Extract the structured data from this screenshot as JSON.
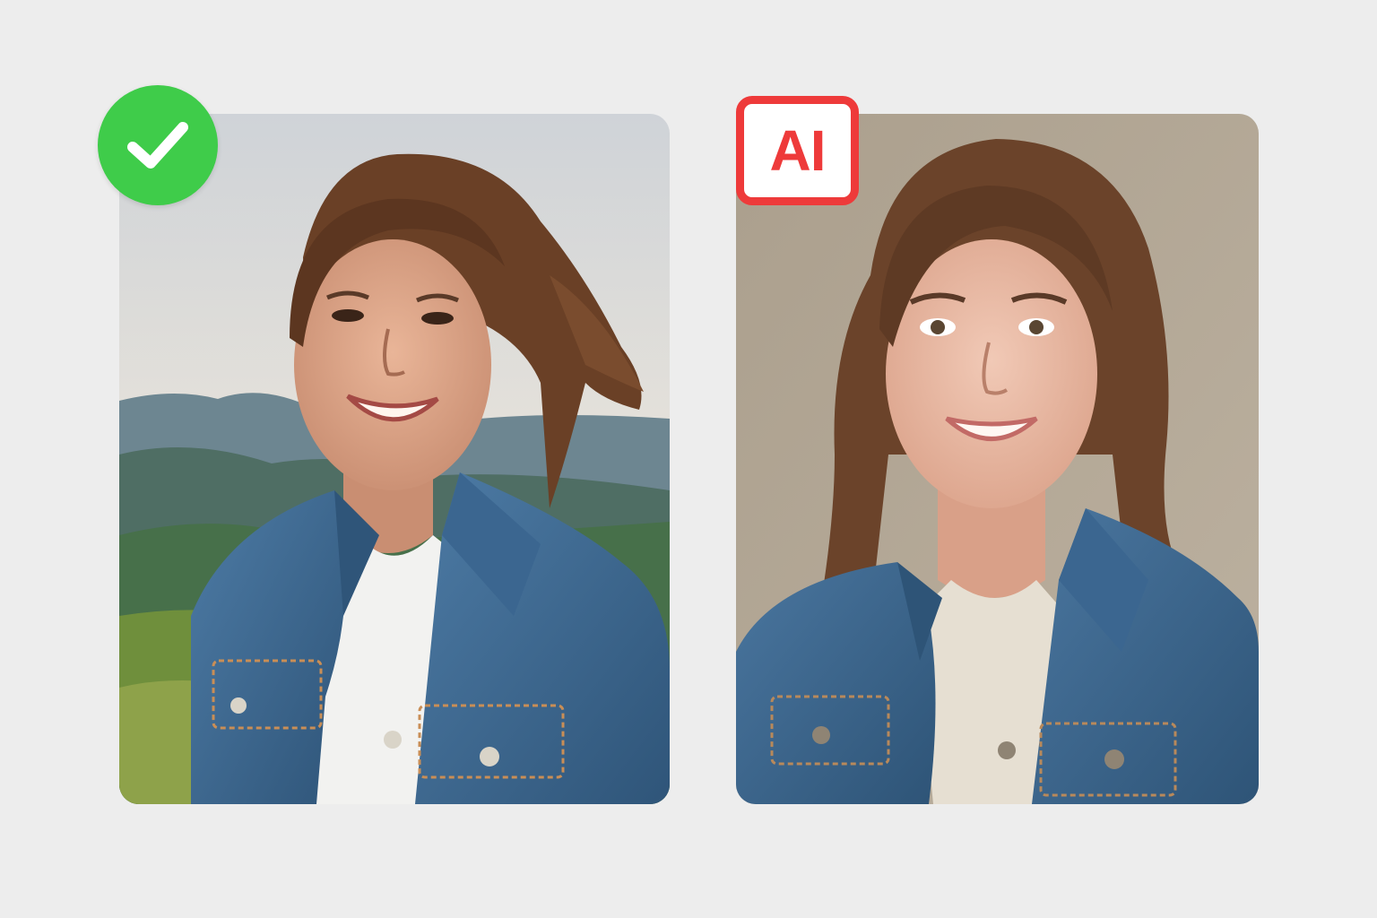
{
  "badges": {
    "real": {
      "icon": "check-icon",
      "color": "#3fcc4a"
    },
    "ai": {
      "label": "AI",
      "color": "#ee3a3a"
    }
  },
  "photos": {
    "real": {
      "subject": "photo-real-portrait"
    },
    "ai": {
      "subject": "photo-ai-portrait"
    }
  },
  "colors": {
    "background": "#ededed",
    "denim": "#3e6a95",
    "hair": "#6a4026"
  }
}
